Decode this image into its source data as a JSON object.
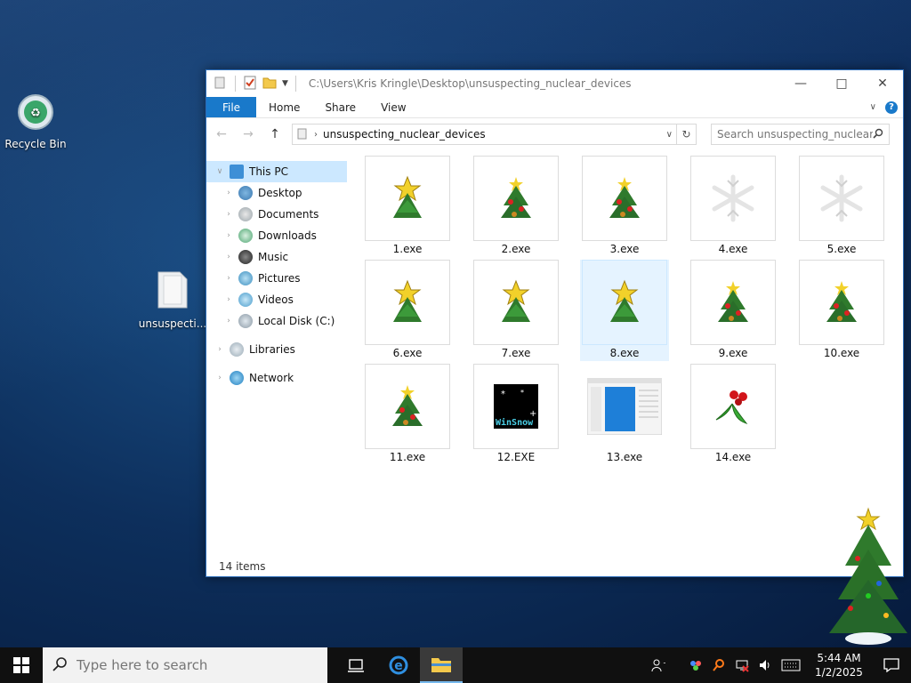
{
  "desktop": {
    "icons": [
      {
        "label": "Recycle Bin",
        "icon": "recycle-bin-icon"
      },
      {
        "label": "unsuspecting_nuclear_devices",
        "short_label": "unsuspecti...",
        "icon": "folder-icon"
      }
    ]
  },
  "explorer": {
    "title": "C:\\Users\\Kris Kringle\\Desktop\\unsuspecting_nuclear_devices",
    "ribbon_tabs": [
      "File",
      "Home",
      "Share",
      "View"
    ],
    "address": "unsuspecting_nuclear_devices",
    "search_placeholder": "Search unsuspecting_nuclear_...",
    "nav": {
      "this_pc": "This PC",
      "items": [
        "Desktop",
        "Documents",
        "Downloads",
        "Music",
        "Pictures",
        "Videos",
        "Local Disk (C:)"
      ],
      "libraries": "Libraries",
      "network": "Network"
    },
    "files": [
      {
        "name": "1.exe",
        "icon": "star-tree-icon"
      },
      {
        "name": "2.exe",
        "icon": "ornament-tree-icon"
      },
      {
        "name": "3.exe",
        "icon": "ornament-tree-icon"
      },
      {
        "name": "4.exe",
        "icon": "snowflake-icon"
      },
      {
        "name": "5.exe",
        "icon": "snowflake-icon"
      },
      {
        "name": "6.exe",
        "icon": "star-tree-icon"
      },
      {
        "name": "7.exe",
        "icon": "star-tree-icon"
      },
      {
        "name": "8.exe",
        "icon": "star-tree-icon",
        "selected": true
      },
      {
        "name": "9.exe",
        "icon": "ornament-tree-icon"
      },
      {
        "name": "10.exe",
        "icon": "ornament-tree-icon"
      },
      {
        "name": "11.exe",
        "icon": "ornament-tree-icon"
      },
      {
        "name": "12.EXE",
        "icon": "winsnow-icon",
        "caption": "WinSnow"
      },
      {
        "name": "13.exe",
        "icon": "window-app-icon"
      },
      {
        "name": "14.exe",
        "icon": "holly-icon"
      }
    ],
    "status": "14 items"
  },
  "taskbar": {
    "search_placeholder": "Type here to search",
    "time": "5:44 AM",
    "date": "1/2/2025"
  },
  "colors": {
    "accent": "#1979ca",
    "selection": "#cce8ff",
    "taskbar": "#101010"
  }
}
